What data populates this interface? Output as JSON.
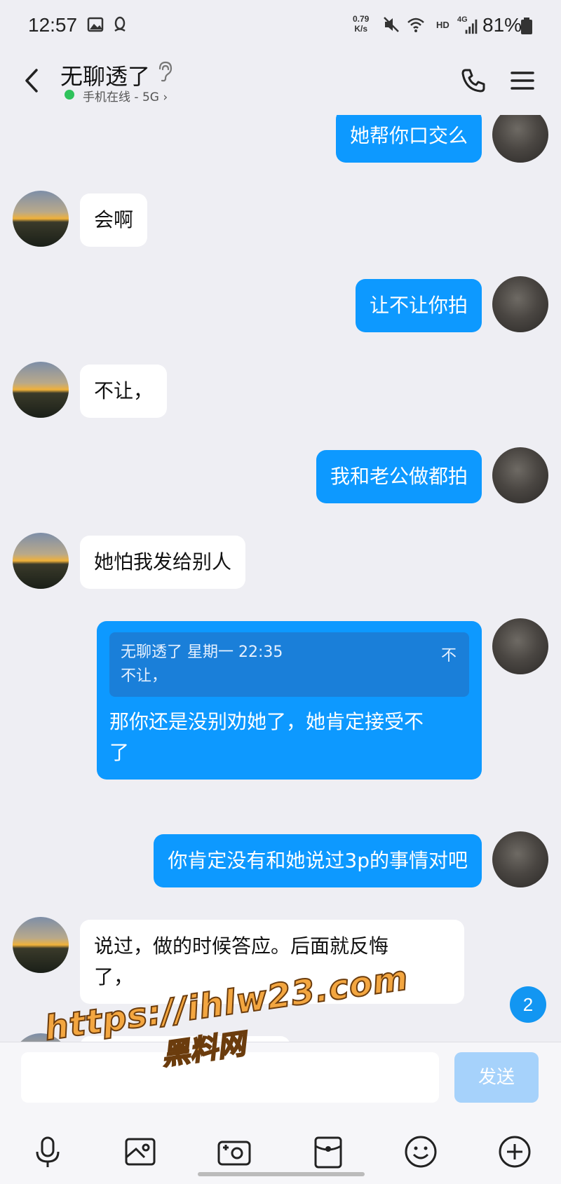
{
  "status_bar": {
    "time": "12:57",
    "net_speed_value": "0.79",
    "net_speed_unit": "K/s",
    "hd": "HD",
    "signal": "4G",
    "battery": "81%"
  },
  "header": {
    "title": "无聊透了",
    "status": "手机在线 - 5G",
    "status_chevron": "›"
  },
  "messages": [
    {
      "side": "out",
      "text": "她帮你口交么"
    },
    {
      "side": "in",
      "text": "会啊"
    },
    {
      "side": "out",
      "text": "让不让你拍"
    },
    {
      "side": "in",
      "text": "不让，"
    },
    {
      "side": "out",
      "text": "我和老公做都拍"
    },
    {
      "side": "in",
      "text": "她怕我发给别人"
    },
    {
      "side": "out",
      "quote_header": "无聊透了 星期一 22:35",
      "quote_body": "不让，",
      "quote_more": "不",
      "text_line1": "那你还是没别劝她了，她肯定接受不",
      "text_line2": "了"
    },
    {
      "side": "out",
      "text": "你肯定没有和她说过3p的事情对吧"
    },
    {
      "side": "in",
      "text_line1": "说过，做的时候答应。后面就反悔",
      "text_line2": "了，"
    }
  ],
  "unread_count": "2",
  "input": {
    "value": "",
    "send_label": "发送"
  },
  "watermark": {
    "url": "https://ihlw23.com",
    "name": "黑料网"
  },
  "colors": {
    "outgoing_bubble": "#0d99ff",
    "incoming_bubble": "#ffffff",
    "background": "#eeeef3",
    "send_disabled": "#a6d2fb",
    "online_dot": "#2fc25b"
  },
  "icons": {
    "toolbar": [
      "microphone-icon",
      "image-icon",
      "camera-icon",
      "red-packet-icon",
      "emoji-icon",
      "plus-icon"
    ]
  }
}
